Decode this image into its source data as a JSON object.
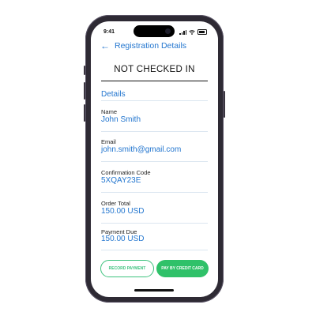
{
  "status_bar": {
    "time": "9:41"
  },
  "header": {
    "back_icon": "arrow-left-icon",
    "title": "Registration Details"
  },
  "check_status": "NOT CHECKED IN",
  "details": {
    "title": "Details",
    "fields": [
      {
        "label": "Name",
        "value": "John Smith"
      },
      {
        "label": "Email",
        "value": "john.smith@gmail.com"
      },
      {
        "label": "Confirmation Code",
        "value": "5XQAY23E"
      },
      {
        "label": "Order Total",
        "value": "150.00 USD"
      },
      {
        "label": "Payment Due",
        "value": "150.00 USD"
      }
    ]
  },
  "actions": {
    "record_payment": "RECORD PAYMENT",
    "pay_by_card": "PAY BY CREDIT CARD"
  },
  "colors": {
    "accent": "#2376cf",
    "success": "#2fc169",
    "frame": "#2e2a34"
  }
}
